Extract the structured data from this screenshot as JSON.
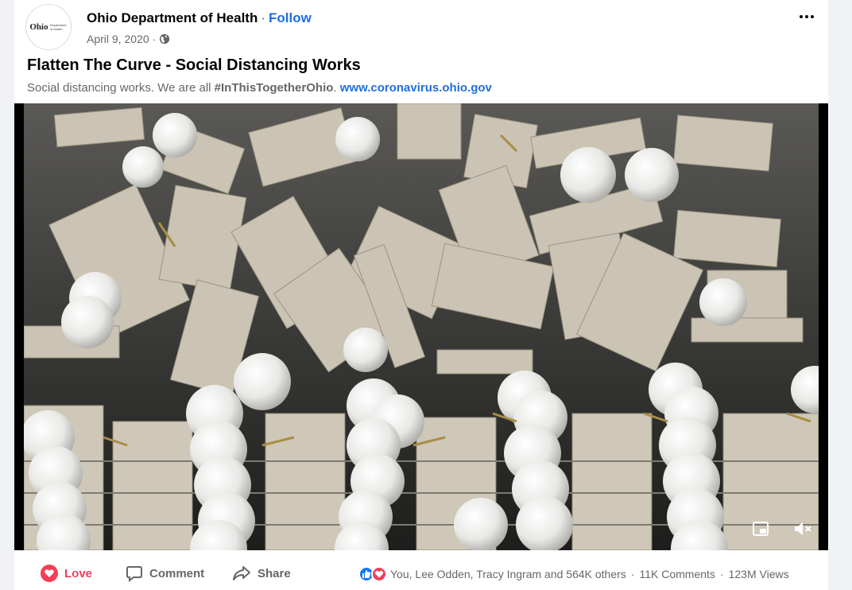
{
  "post": {
    "page_name": "Ohio Department of Health",
    "separator": "·",
    "follow_label": "Follow",
    "date": "April 9, 2020",
    "date_separator": "·",
    "privacy_icon": "globe-icon",
    "more_icon": "more-horizontal-icon",
    "title": "Flatten The Curve - Social Distancing Works",
    "description_text": "Social distancing works. We are all ",
    "hashtag": "#InThisTogetherOhio",
    "description_between": ". ",
    "link": "www.coronavirus.ohio.gov"
  },
  "logo": {
    "wordmark": "Ohio",
    "subtitle": "Department of Health"
  },
  "video": {
    "pip_icon": "picture-in-picture-icon",
    "mute_icon": "volume-muted-icon"
  },
  "actions": {
    "love_label": "Love",
    "comment_label": "Comment",
    "share_label": "Share"
  },
  "stats": {
    "reactions_text": "You, Lee Odden, Tracy Ingram and 564K others",
    "separator": "·",
    "comments": "11K Comments",
    "views": "123M Views"
  },
  "colors": {
    "link": "#216fdb",
    "love": "#f33e58",
    "like": "#1877f2",
    "muted_text": "#65676b"
  }
}
